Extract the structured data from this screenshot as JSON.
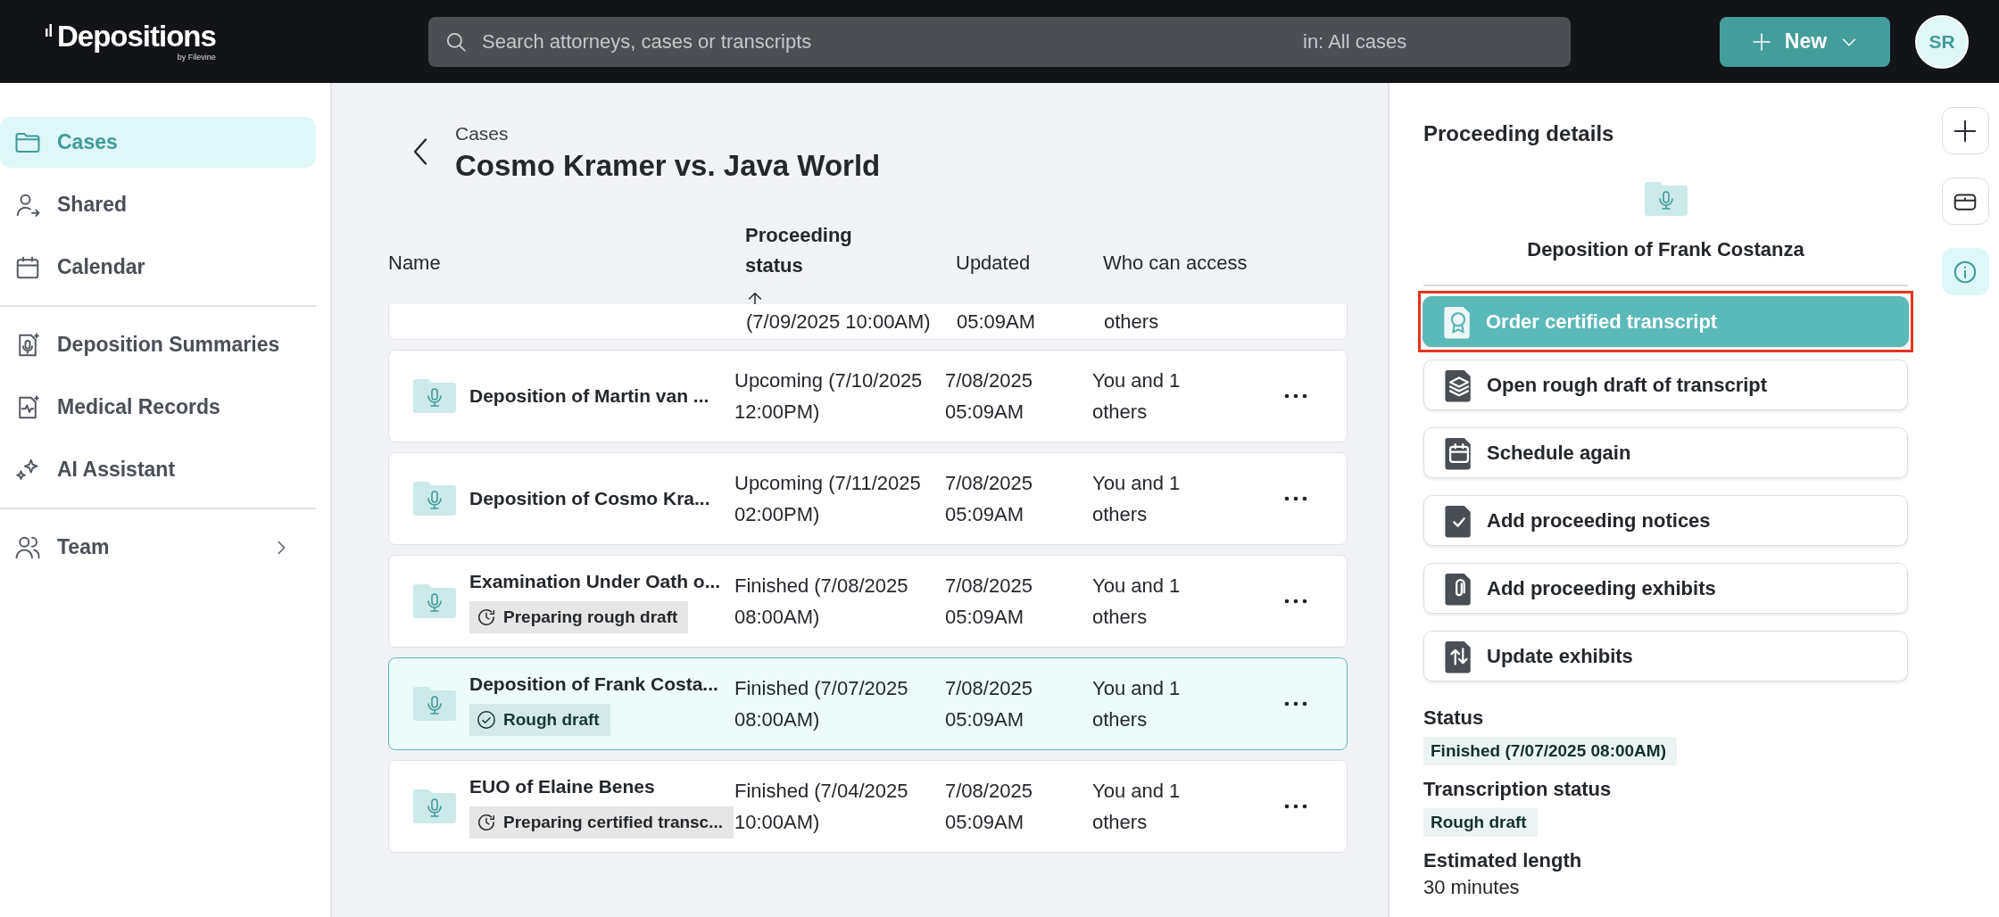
{
  "header": {
    "logo": "Depositions",
    "logo_sub": "by Filevine",
    "search": {
      "placeholder": "Search attorneys, cases or transcripts",
      "scope": "in: All cases"
    },
    "new_button": "New",
    "avatar": "SR"
  },
  "sidebar": {
    "groups": [
      [
        {
          "label": "Cases",
          "selected": true,
          "expandable": false
        },
        {
          "label": "Shared",
          "selected": false,
          "expandable": false
        },
        {
          "label": "Calendar",
          "selected": false,
          "expandable": false
        }
      ],
      [
        {
          "label": "Deposition Summaries",
          "selected": false,
          "expandable": false
        },
        {
          "label": "Medical Records",
          "selected": false,
          "expandable": false
        },
        {
          "label": "AI Assistant",
          "selected": false,
          "expandable": false
        }
      ],
      [
        {
          "label": "Team",
          "selected": false,
          "expandable": true
        }
      ]
    ]
  },
  "breadcrumb": "Cases",
  "title": "Cosmo Kramer vs. Java World",
  "table": {
    "columns": [
      {
        "label": "Name",
        "sorted": false
      },
      {
        "label": "Proceeding status",
        "sorted": true
      },
      {
        "label": "Updated",
        "sorted": false
      },
      {
        "label": "Who can access",
        "sorted": false
      }
    ],
    "rows": [
      {
        "kind": "partial",
        "status": "(7/09/2025 10:00AM)",
        "updated": "05:09AM",
        "access": "others",
        "selected": false
      },
      {
        "kind": "full",
        "name": "Deposition of Martin van ...",
        "status": "Upcoming (7/10/2025 12:00PM)",
        "updated": "7/08/2025 05:09AM",
        "access": "You and 1 others",
        "selected": false
      },
      {
        "kind": "full",
        "name": "Deposition of Cosmo Kra...",
        "status": "Upcoming (7/11/2025 02:00PM)",
        "updated": "7/08/2025 05:09AM",
        "access": "You and 1 others",
        "selected": false
      },
      {
        "kind": "full",
        "name": "Examination Under Oath o...",
        "badge": {
          "kind": "pending",
          "text": "Preparing rough draft"
        },
        "status": "Finished (7/08/2025 08:00AM)",
        "updated": "7/08/2025 05:09AM",
        "access": "You and 1 others",
        "selected": false
      },
      {
        "kind": "full",
        "name": "Deposition of Frank Costa...",
        "badge": {
          "kind": "done",
          "text": "Rough draft"
        },
        "status": "Finished (7/07/2025 08:00AM)",
        "updated": "7/08/2025 05:09AM",
        "access": "You and 1 others",
        "selected": true
      },
      {
        "kind": "full",
        "name": "EUO of Elaine Benes",
        "badge": {
          "kind": "pending",
          "text": "Preparing certified transc..."
        },
        "status": "Finished (7/04/2025 10:00AM)",
        "updated": "7/08/2025 05:09AM",
        "access": "You and 1 others",
        "selected": false
      }
    ]
  },
  "details": {
    "heading": "Proceeding details",
    "name": "Deposition of Frank Costanza",
    "actions": [
      {
        "label": "Order certified transcript",
        "selected": true,
        "highlighted": true
      },
      {
        "label": "Open rough draft of transcript",
        "selected": false,
        "highlighted": false
      },
      {
        "label": "Schedule again",
        "selected": false,
        "highlighted": false
      },
      {
        "label": "Add proceeding notices",
        "selected": false,
        "highlighted": false
      },
      {
        "label": "Add proceeding exhibits",
        "selected": false,
        "highlighted": false
      },
      {
        "label": "Update exhibits",
        "selected": false,
        "highlighted": false
      }
    ],
    "fields": [
      {
        "label": "Status",
        "value": "Finished (7/07/2025 08:00AM)",
        "kind": "badge"
      },
      {
        "label": "Transcription status",
        "value": "Rough draft",
        "kind": "badge"
      },
      {
        "label": "Estimated length",
        "value": "30 minutes",
        "kind": "text"
      }
    ]
  },
  "rail": [
    {
      "selected": false
    },
    {
      "selected": false
    },
    {
      "selected": true
    }
  ]
}
